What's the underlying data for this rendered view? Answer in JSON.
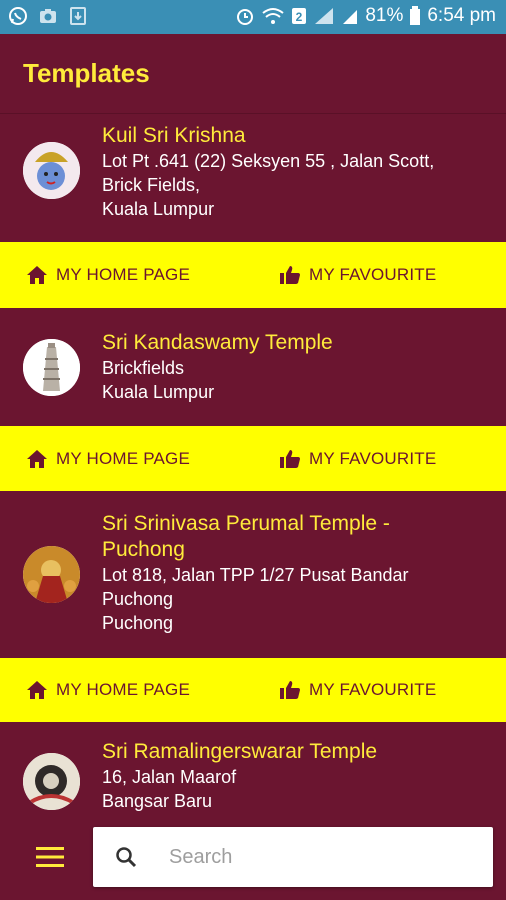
{
  "status_bar": {
    "battery": "81%",
    "time": "6:54 pm",
    "icons_left": [
      "whatsapp-icon",
      "camera-icon",
      "download-icon"
    ],
    "icons_right": [
      "alarm-icon",
      "wifi-icon",
      "sim2-icon",
      "signal-icon",
      "signal-icon",
      "battery-icon"
    ]
  },
  "app_bar": {
    "title": "Templates"
  },
  "actions": {
    "home_label": "MY HOME PAGE",
    "fav_label": "MY FAVOURITE"
  },
  "temples": [
    {
      "name": "Kuil Sri Krishna",
      "address": [
        "Lot Pt .641 (22) Seksyen 55 , Jalan Scott,",
        "Brick Fields,",
        "Kuala Lumpur"
      ]
    },
    {
      "name": "Sri Kandaswamy Temple",
      "address": [
        "Brickfields",
        "Kuala Lumpur"
      ]
    },
    {
      "name_lines": [
        "Sri Srinivasa Perumal Temple -",
        "Puchong"
      ],
      "address": [
        "Lot 818, Jalan TPP 1/27 Pusat Bandar",
        "Puchong",
        "Puchong"
      ]
    },
    {
      "name": "Sri Ramalingerswarar Temple",
      "address": [
        "16, Jalan Maarof",
        "Bangsar Baru"
      ]
    }
  ],
  "search": {
    "placeholder": "Search",
    "value": ""
  },
  "colors": {
    "primary": "#6b1530",
    "accent": "#ffeb3b",
    "action_bg": "#ffff00",
    "status_bar": "#3a8fb5"
  }
}
